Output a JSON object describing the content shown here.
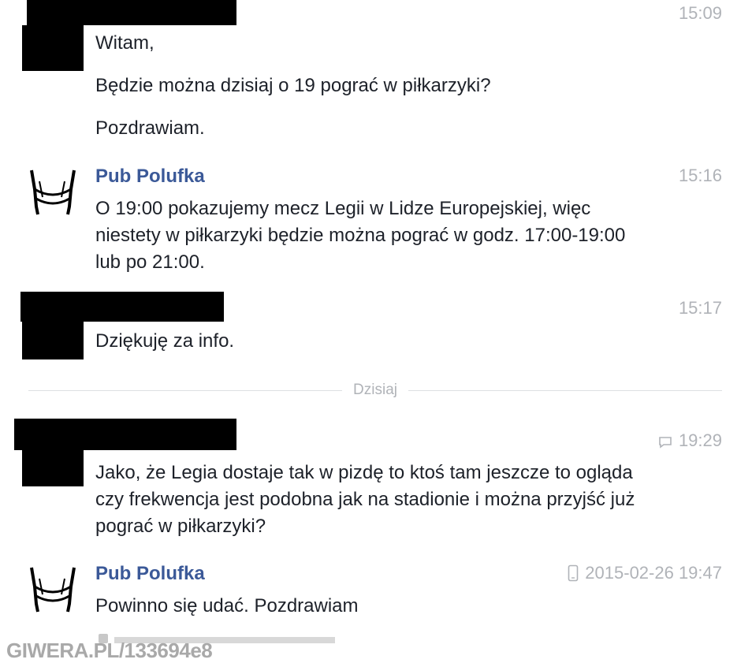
{
  "messages": [
    {
      "time": "15:09",
      "paragraphs": [
        "Witam,",
        "Będzie można dzisiaj o 19 pograć w piłkarzyki?",
        "Pozdrawiam."
      ]
    },
    {
      "sender": "Pub Polufka",
      "time": "15:16",
      "paragraphs": [
        "O 19:00 pokazujemy mecz Legii w Lidze Europejskiej, więc niestety w piłkarzyki będzie można pograć w godz. 17:00-19:00 lub po 21:00."
      ]
    },
    {
      "time": "15:17",
      "paragraphs": [
        "Dziękuję za info."
      ]
    },
    {
      "time": "19:29",
      "time_icon": "chat-bubble-icon",
      "paragraphs": [
        "Jako, że Legia dostaje tak w pizdę to ktoś tam jeszcze to ogląda czy frekwencja jest podobna jak na stadionie i można przyjść już pograć w piłkarzyki?"
      ]
    },
    {
      "sender": "Pub Polufka",
      "time": "2015-02-26 19:47",
      "time_icon": "mobile-phone-icon",
      "paragraphs": [
        "Powinno się udać. Pozdrawiam"
      ]
    }
  ],
  "divider": {
    "label": "Dzisiaj"
  },
  "watermark": "GIWERA.PL/133694e8"
}
